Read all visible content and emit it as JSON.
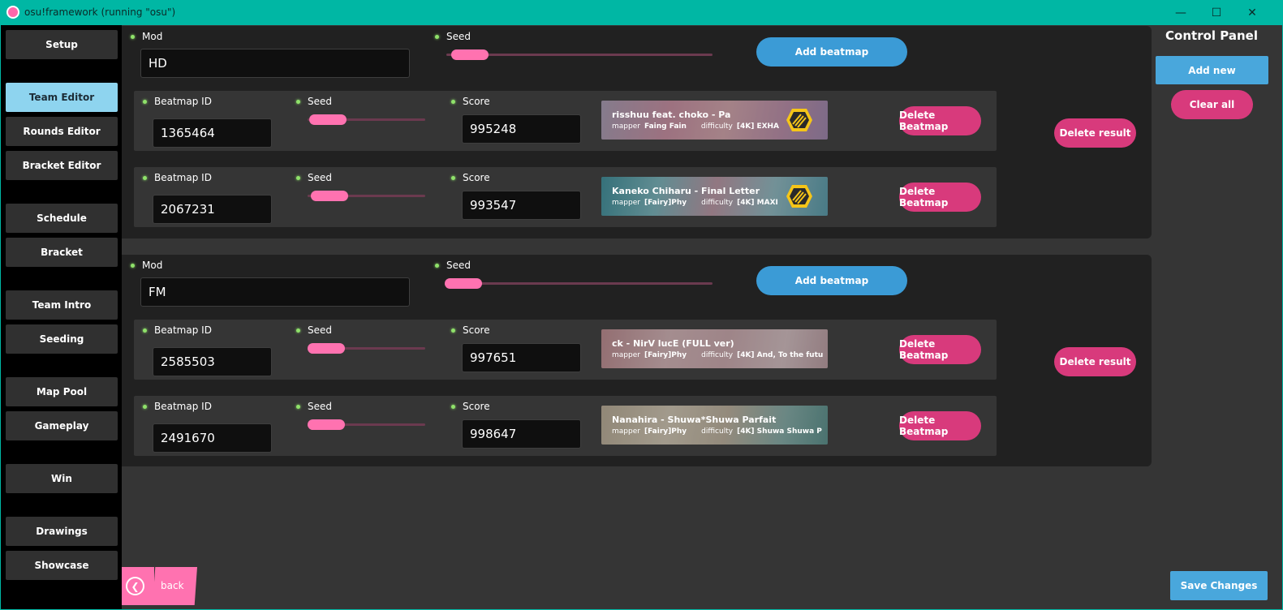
{
  "window": {
    "title": "osu!framework (running \"osu\")",
    "minimize_glyph": "—",
    "maximize_glyph": "☐",
    "close_glyph": "✕"
  },
  "sidebar": {
    "items": [
      {
        "label": "Setup",
        "active": false
      },
      {
        "label": "Team Editor",
        "active": true
      },
      {
        "label": "Rounds Editor",
        "active": false
      },
      {
        "label": "Bracket Editor",
        "active": false
      },
      {
        "label": "Schedule",
        "active": false
      },
      {
        "label": "Bracket",
        "active": false
      },
      {
        "label": "Team Intro",
        "active": false
      },
      {
        "label": "Seeding",
        "active": false
      },
      {
        "label": "Map Pool",
        "active": false
      },
      {
        "label": "Gameplay",
        "active": false
      },
      {
        "label": "Win",
        "active": false
      },
      {
        "label": "Drawings",
        "active": false
      },
      {
        "label": "Showcase",
        "active": false
      }
    ]
  },
  "labels": {
    "mod": "Mod",
    "seed": "Seed",
    "beatmap_id": "Beatmap ID",
    "score": "Score",
    "add_beatmap": "Add beatmap",
    "delete_beatmap": "Delete Beatmap",
    "delete_result": "Delete result",
    "mapper": "mapper",
    "difficulty": "difficulty"
  },
  "groups": [
    {
      "mod": "HD",
      "beatmaps": [
        {
          "id": "1365464",
          "score": "995248",
          "title": "risshuu feat. choko - Pa",
          "mapper": "Faing Fain",
          "difficulty": "[4K] EXHA"
        },
        {
          "id": "2067231",
          "score": "993547",
          "title": "Kaneko Chiharu - Final Letter",
          "mapper": "[Fairy]Phy",
          "difficulty": "[4K] MAXI"
        }
      ]
    },
    {
      "mod": "FM",
      "beatmaps": [
        {
          "id": "2585503",
          "score": "997651",
          "title": "ck - NirV lucE (FULL ver)",
          "mapper": "[Fairy]Phy",
          "difficulty": "[4K] And, To the futu"
        },
        {
          "id": "2491670",
          "score": "998647",
          "title": "Nanahira - Shuwa*Shuwa Parfait",
          "mapper": "[Fairy]Phy",
          "difficulty": "[4K] Shuwa Shuwa P"
        }
      ]
    }
  ],
  "control_panel": {
    "title": "Control Panel",
    "add_new": "Add new",
    "clear_all": "Clear all",
    "save_changes": "Save Changes"
  },
  "back": {
    "label": "back"
  },
  "colors": {
    "titlebar": "#00b7a4",
    "active_sidebar": "#8ed4ef",
    "pink": "#d83a7c",
    "blue": "#3b9bd6",
    "slider": "#ff72b0"
  }
}
